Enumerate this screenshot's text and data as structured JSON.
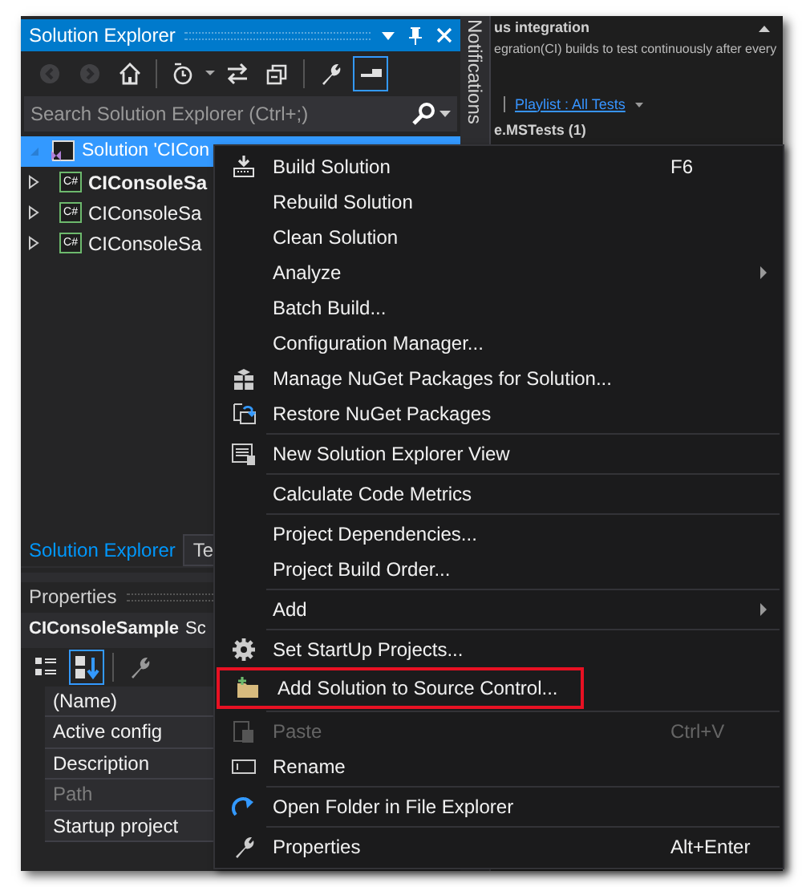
{
  "solution_explorer": {
    "title": "Solution Explorer",
    "toolbar": [
      {
        "kind": "back",
        "disabled": true,
        "selected": false
      },
      {
        "kind": "forward",
        "disabled": true,
        "selected": false
      },
      {
        "kind": "home",
        "disabled": false,
        "selected": false
      },
      {
        "kind": "history",
        "disabled": false,
        "selected": false
      },
      {
        "kind": "sync",
        "disabled": false,
        "selected": false
      },
      {
        "kind": "collapse",
        "disabled": false,
        "selected": false
      },
      {
        "kind": "properties",
        "disabled": false,
        "selected": false
      },
      {
        "kind": "preview",
        "disabled": false,
        "selected": true
      }
    ],
    "search": {
      "placeholder": "Search Solution Explorer (Ctrl+;)"
    },
    "tree": [
      {
        "kind": "solution",
        "label": "Solution 'CICon",
        "bold": false,
        "selected": true,
        "expanded": true
      },
      {
        "kind": "project",
        "badge": "C#",
        "label": "CIConsoleSa",
        "bold": true,
        "selected": false,
        "expanded": false
      },
      {
        "kind": "project",
        "badge": "C#",
        "label": "CIConsoleSa",
        "bold": false,
        "selected": false,
        "expanded": false
      },
      {
        "kind": "project",
        "badge": "C#",
        "label": "CIConsoleSa",
        "bold": false,
        "selected": false,
        "expanded": false
      }
    ],
    "tabs": [
      {
        "label": "Solution Explorer",
        "selected": true
      },
      {
        "label": "Te",
        "selected": false
      }
    ]
  },
  "notifications": {
    "label": "Notifications"
  },
  "background_panel": {
    "lines": [
      {
        "kind": "heading",
        "text": "us integration"
      },
      {
        "kind": "body",
        "text": "egration(CI) builds to test continuously after every"
      },
      {
        "kind": "link",
        "text": "Playlist : All Tests"
      },
      {
        "kind": "heading",
        "text": "e.MSTests (1)"
      }
    ]
  },
  "properties": {
    "title": "Properties",
    "object": "CIConsoleSample",
    "object_type": "Sc",
    "toolbar": [
      {
        "kind": "categorized",
        "selected": false
      },
      {
        "kind": "alphabetical",
        "selected": true
      },
      {
        "kind": "pages",
        "selected": false
      }
    ],
    "rows": [
      {
        "name": "(Name)",
        "disabled": false
      },
      {
        "name": "Active config",
        "disabled": false
      },
      {
        "name": "Description",
        "disabled": false
      },
      {
        "name": "Path",
        "disabled": true
      },
      {
        "name": "Startup project",
        "disabled": false
      }
    ]
  },
  "context_menu": {
    "items": [
      {
        "kind": "item",
        "label": "Build Solution",
        "shortcut": "F6",
        "submenu": false,
        "disabled": false,
        "highlighted": false
      },
      {
        "kind": "item",
        "label": "Rebuild Solution",
        "submenu": false,
        "disabled": false,
        "highlighted": false
      },
      {
        "kind": "item",
        "label": "Clean Solution",
        "submenu": false,
        "disabled": false,
        "highlighted": false
      },
      {
        "kind": "item",
        "label": "Analyze",
        "submenu": true,
        "disabled": false,
        "highlighted": false
      },
      {
        "kind": "item",
        "label": "Batch Build...",
        "submenu": false,
        "disabled": false,
        "highlighted": false
      },
      {
        "kind": "item",
        "label": "Configuration Manager...",
        "submenu": false,
        "disabled": false,
        "highlighted": false
      },
      {
        "kind": "item",
        "label": "Manage NuGet Packages for Solution...",
        "submenu": false,
        "disabled": false,
        "highlighted": false
      },
      {
        "kind": "item",
        "label": "Restore NuGet Packages",
        "submenu": false,
        "disabled": false,
        "highlighted": false
      },
      {
        "kind": "separator"
      },
      {
        "kind": "item",
        "label": "New Solution Explorer View",
        "submenu": false,
        "disabled": false,
        "highlighted": false
      },
      {
        "kind": "separator"
      },
      {
        "kind": "item",
        "label": "Calculate Code Metrics",
        "submenu": false,
        "disabled": false,
        "highlighted": false
      },
      {
        "kind": "separator"
      },
      {
        "kind": "item",
        "label": "Project Dependencies...",
        "submenu": false,
        "disabled": false,
        "highlighted": false
      },
      {
        "kind": "item",
        "label": "Project Build Order...",
        "submenu": false,
        "disabled": false,
        "highlighted": false
      },
      {
        "kind": "separator"
      },
      {
        "kind": "item",
        "label": "Add",
        "submenu": true,
        "disabled": false,
        "highlighted": false
      },
      {
        "kind": "separator"
      },
      {
        "kind": "item",
        "label": "Set StartUp Projects...",
        "submenu": false,
        "disabled": false,
        "highlighted": false
      },
      {
        "kind": "item",
        "label": "Add Solution to Source Control...",
        "submenu": false,
        "disabled": false,
        "highlighted": true
      },
      {
        "kind": "separator"
      },
      {
        "kind": "item",
        "label": "Paste",
        "shortcut": "Ctrl+V",
        "submenu": false,
        "disabled": true,
        "highlighted": false
      },
      {
        "kind": "item",
        "label": "Rename",
        "submenu": false,
        "disabled": false,
        "highlighted": false
      },
      {
        "kind": "separator"
      },
      {
        "kind": "item",
        "label": "Open Folder in File Explorer",
        "submenu": false,
        "disabled": false,
        "highlighted": false
      },
      {
        "kind": "separator"
      },
      {
        "kind": "item",
        "label": "Properties",
        "shortcut": "Alt+Enter",
        "submenu": false,
        "disabled": false,
        "highlighted": false
      }
    ]
  }
}
